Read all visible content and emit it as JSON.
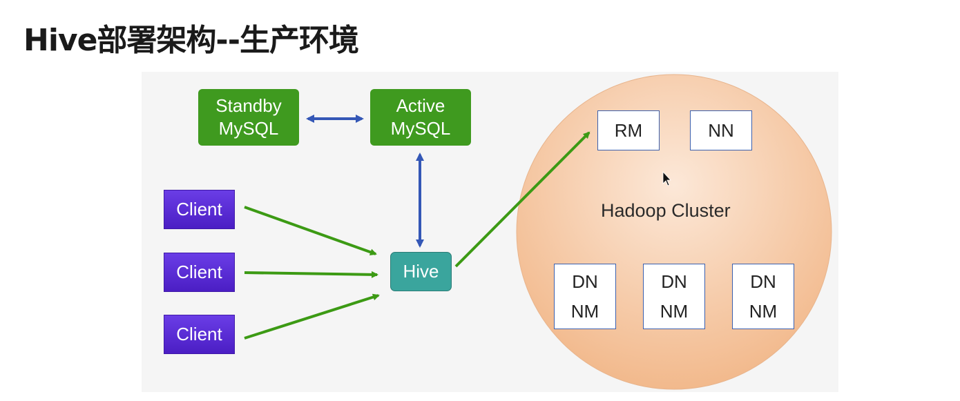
{
  "title": "Hive部署架构--生产环境",
  "nodes": {
    "standby_mysql": [
      "Standby",
      "MySQL"
    ],
    "active_mysql": [
      "Active",
      "MySQL"
    ],
    "clients": [
      "Client",
      "Client",
      "Client"
    ],
    "hive": "Hive",
    "rm": "RM",
    "nn": "NN",
    "dn_nm": [
      [
        "DN",
        "NM"
      ],
      [
        "DN",
        "NM"
      ],
      [
        "DN",
        "NM"
      ]
    ]
  },
  "cluster_label": "Hadoop Cluster",
  "colors": {
    "mysql": "#3f9a1f",
    "client": "#5a2ed8",
    "hive": "#3aa59d",
    "cluster_fill": "#f5c9a4",
    "arrow_green": "#3c9a14",
    "arrow_blue": "#3457b6"
  }
}
